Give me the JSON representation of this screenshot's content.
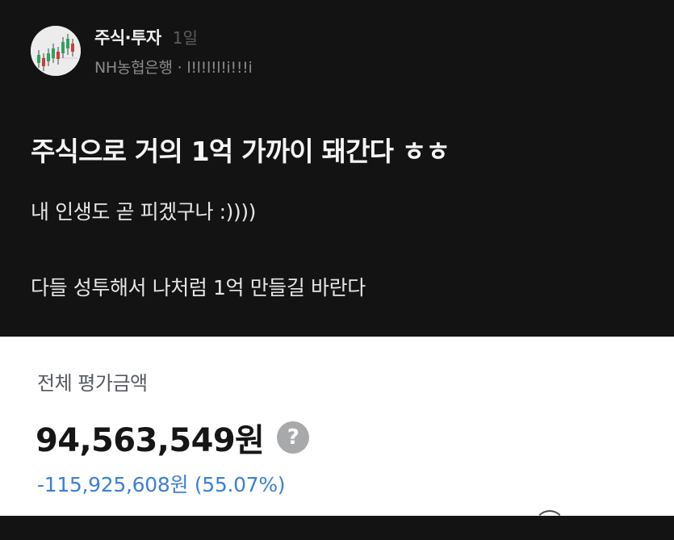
{
  "post": {
    "board": "주식·투자",
    "time_ago": "1일",
    "company": "NH농협은행",
    "separator": "·",
    "nickname": "l!l!l!l!i!!!i",
    "title": "주식으로 거의 1억 가까이 돼간다 ㅎㅎ",
    "lines": [
      "내 인생도 곧 피겠구나 :))))",
      "다들 성투해서 나처럼 1억 만들길 바란다"
    ]
  },
  "asset_panel": {
    "label": "전체 평가금액",
    "amount": "94,563,549원",
    "help_symbol": "?",
    "change": "-115,925,608원 (55.07%)"
  },
  "icons": {
    "avatar": "stock-candlestick-chart-avatar",
    "help": "question-mark-icon"
  },
  "colors": {
    "background": "#131313",
    "panel": "#ffffff",
    "change_text": "#3b7fd6",
    "help_icon": "#a8a9ab"
  }
}
